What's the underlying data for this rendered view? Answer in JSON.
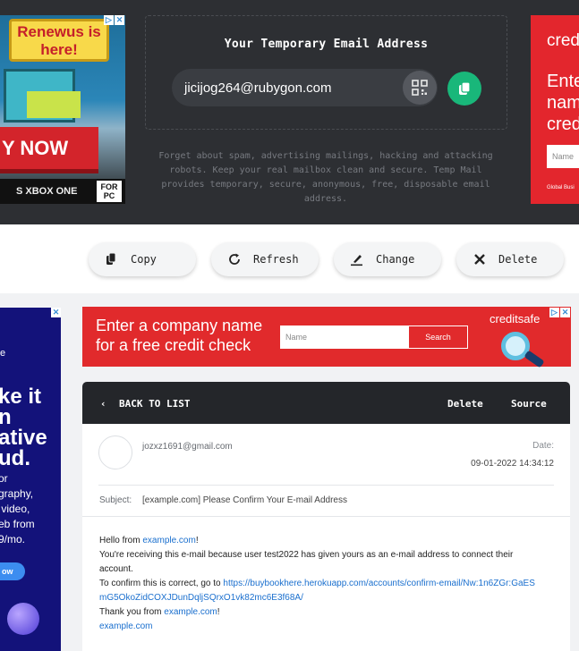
{
  "ad_top_left": {
    "headline": "Renewus is here!",
    "cta": "Y NOW",
    "platforms": "S  XBOX ONE",
    "pc_badge": "FOR PC"
  },
  "email_panel": {
    "title": "Your Temporary Email Address",
    "address": "jicijog264@rubygon.com",
    "description": "Forget about spam, advertising mailings, hacking and attacking robots. Keep your real mailbox clean and secure. Temp Mail provides temporary, secure, anonymous, free, disposable email address."
  },
  "ad_top_right": {
    "logo": "cred",
    "headline": "Ente nam cred",
    "input_placeholder": "Name",
    "fine_print": "Global Busi"
  },
  "actions": [
    {
      "label": "Copy",
      "icon": "copy-icon"
    },
    {
      "label": "Refresh",
      "icon": "refresh-icon"
    },
    {
      "label": "Change",
      "icon": "edit-icon"
    },
    {
      "label": "Delete",
      "icon": "close-icon"
    }
  ],
  "ad_side": {
    "line0": "e",
    "headline": "ke it\nn\native\nud.",
    "body": "or\ngraphy,\n video,\neb from\n9/mo.",
    "cta": "ow"
  },
  "ad_banner": {
    "text": "Enter a company name\nfor a free credit check",
    "input_placeholder": "Name",
    "button": "Search",
    "logo": "creditsafe"
  },
  "message": {
    "back_label": "BACK TO LIST",
    "delete_label": "Delete",
    "source_label": "Source",
    "from": "jozxz1691@gmail.com",
    "date_label": "Date:",
    "date_value": "09-01-2022 14:34:12",
    "subject_label": "Subject:",
    "subject": "[example.com] Please Confirm Your E-mail Address",
    "body": {
      "hello_prefix": "Hello from ",
      "hello_link": "example.com",
      "hello_suffix": "!",
      "line2": "You're receiving this e-mail because user test2022 has given yours as an e-mail address to connect their account.",
      "confirm_prefix": "To confirm this is correct, go to ",
      "confirm_link": "https://buybookhere.herokuapp.com/accounts/confirm-email/Nw:1n6ZGr:GaESmG5OkoZidCOXJDunDqljSQrxO1vk82mc6E3f68A/",
      "thanks_prefix": "Thank you from ",
      "thanks_link": "example.com",
      "thanks_suffix": "!",
      "sign_link": "example.com"
    }
  },
  "colors": {
    "dark_bg": "#2d2f33",
    "accent_green": "#19b77a",
    "ad_red": "#e12a2c",
    "link": "#1a6fce"
  }
}
